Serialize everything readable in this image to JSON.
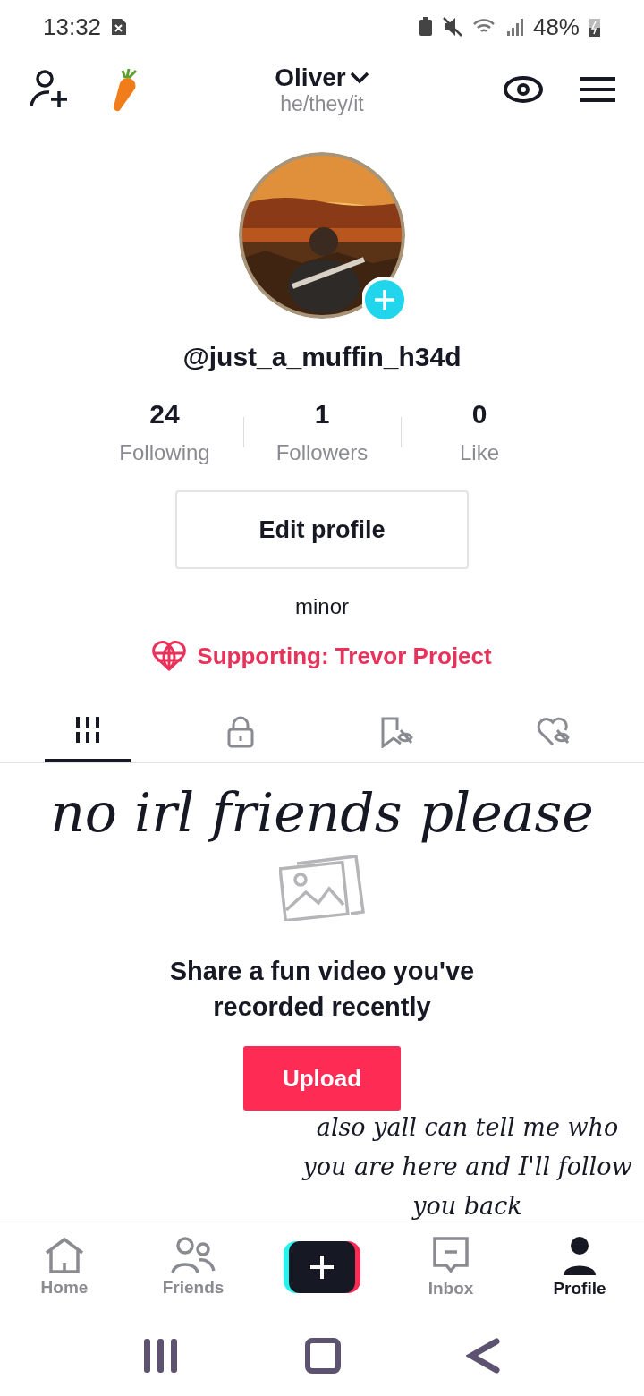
{
  "status_bar": {
    "time": "13:32",
    "battery": "48%"
  },
  "header": {
    "name": "Oliver",
    "pronouns": "he/they/it"
  },
  "profile": {
    "handle": "@just_a_muffin_h34d",
    "stats": [
      {
        "value": "24",
        "label": "Following"
      },
      {
        "value": "1",
        "label": "Followers"
      },
      {
        "value": "0",
        "label": "Like"
      }
    ],
    "edit_button": "Edit profile",
    "bio": "minor",
    "supporting": "Supporting: Trevor Project"
  },
  "content_tabs": [
    {
      "kind": "grid",
      "selected": true
    },
    {
      "kind": "lock",
      "selected": false
    },
    {
      "kind": "bookmark",
      "selected": false
    },
    {
      "kind": "heart",
      "selected": false
    }
  ],
  "overlay_texts": [
    "no irl friends please",
    "also yall can tell me who you are here and I'll follow you back"
  ],
  "empty_state": {
    "message": "Share a fun video you've recorded recently",
    "button": "Upload"
  },
  "bottom_nav": [
    {
      "kind": "home",
      "label": "Home",
      "selected": false
    },
    {
      "kind": "friends",
      "label": "Friends",
      "selected": false
    },
    {
      "kind": "create"
    },
    {
      "kind": "inbox",
      "label": "Inbox",
      "selected": false
    },
    {
      "kind": "profile",
      "label": "Profile",
      "selected": true
    }
  ]
}
